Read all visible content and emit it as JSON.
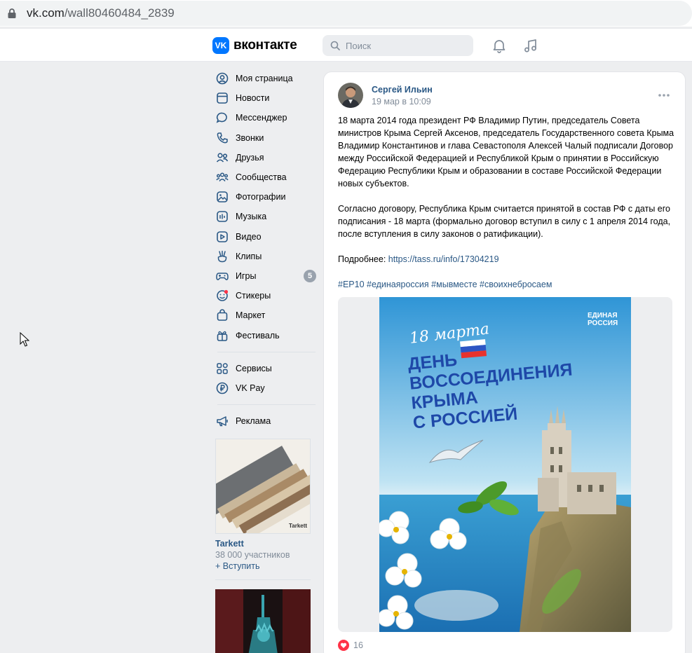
{
  "browser": {
    "url_host": "vk.com",
    "url_path": "/wall80460484_2839"
  },
  "header": {
    "logo_text": "вконтакте",
    "logo_mark": "VK",
    "search_placeholder": "Поиск",
    "icons": [
      "search-icon",
      "bell-icon",
      "music-icon"
    ]
  },
  "sidebar": {
    "items": [
      {
        "label": "Моя страница",
        "icon": "user-circle-icon"
      },
      {
        "label": "Новости",
        "icon": "newsfeed-icon"
      },
      {
        "label": "Мессенджер",
        "icon": "message-icon"
      },
      {
        "label": "Звонки",
        "icon": "phone-icon"
      },
      {
        "label": "Друзья",
        "icon": "friends-icon"
      },
      {
        "label": "Сообщества",
        "icon": "communities-icon"
      },
      {
        "label": "Фотографии",
        "icon": "photo-icon"
      },
      {
        "label": "Музыка",
        "icon": "music-icon"
      },
      {
        "label": "Видео",
        "icon": "video-icon"
      },
      {
        "label": "Клипы",
        "icon": "clips-icon"
      },
      {
        "label": "Игры",
        "icon": "gamepad-icon",
        "badge": "5"
      },
      {
        "label": "Стикеры",
        "icon": "sticker-icon"
      },
      {
        "label": "Маркет",
        "icon": "market-bag-icon"
      },
      {
        "label": "Фестиваль",
        "icon": "gift-icon"
      }
    ],
    "items2": [
      {
        "label": "Сервисы",
        "icon": "services-grid-icon"
      },
      {
        "label": "VK Pay",
        "icon": "ruble-icon"
      }
    ],
    "items3": [
      {
        "label": "Реклама",
        "icon": "megaphone-icon"
      }
    ],
    "ad": {
      "title": "Tarkett",
      "members": "38 000 участников",
      "join": "Вступить",
      "brand": "Tarkett"
    }
  },
  "post": {
    "author": "Сергей Ильин",
    "date": "19 мар в 10:09",
    "paragraph1": "18 марта 2014 года президент РФ Владимир Путин, председатель Совета министров Крыма Сергей Аксенов, председатель Государственного совета Крыма Владимир Константинов и глава Севастополя Алексей Чалый подписали Договор между Российской Федерацией и Республикой Крым о принятии в Российскую Федерацию Республики Крым и образовании в составе Российской Федерации новых субъектов.",
    "paragraph2": "Согласно договору, Республика Крым считается принятой в состав РФ с даты его подписания - 18 марта (формально договор вступил в силу с 1 апреля 2014 года, после вступления в силу законов о ратификации).",
    "more_label": "Подробнее: ",
    "more_link": "https://tass.ru/info/17304219",
    "hashtags": "#ЕР10 #единаяроссия #мывместе #своихнебросаем",
    "image": {
      "date_text": "18 марта",
      "headline": [
        "ДЕНЬ",
        "ВОССОЕДИНЕНИЯ",
        "КРЫМА",
        "С РОССИЕЙ"
      ],
      "brand_line1": "ЕДИНАЯ",
      "brand_line2": "РОССИЯ"
    },
    "likes": "16"
  },
  "colors": {
    "accent": "#0077ff",
    "link": "#2a5885",
    "muted": "#818c99",
    "like": "#ff3347",
    "page_bg": "#edeef0"
  }
}
